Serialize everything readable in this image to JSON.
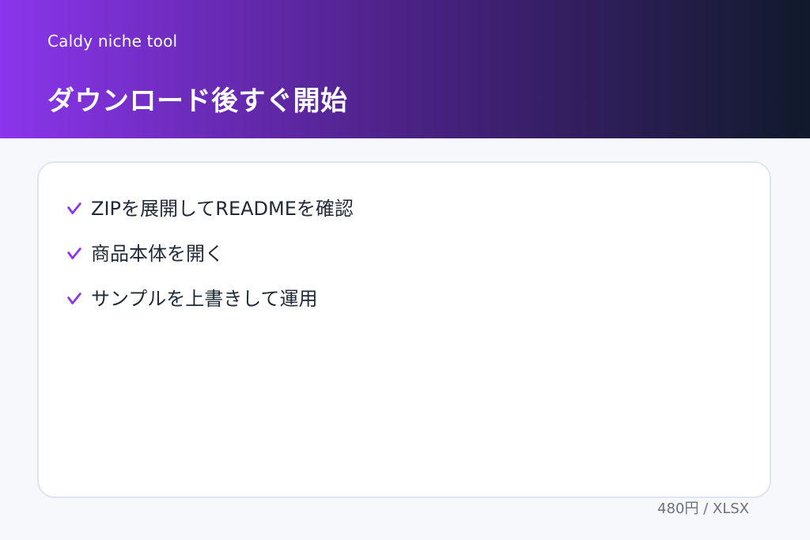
{
  "header": {
    "brand": "Caldy niche tool",
    "title": "ダウンロード後すぐ開始"
  },
  "steps": [
    {
      "label": "ZIPを展開してREADMEを確認",
      "icon": "check-icon"
    },
    {
      "label": "商品本体を開く",
      "icon": "check-icon"
    },
    {
      "label": "サンプルを上書きして運用",
      "icon": "check-icon"
    }
  ],
  "footer": {
    "price_format": "480円 / XLSX"
  },
  "colors": {
    "accent": "#8b35ec",
    "header_dark": "#101a2b",
    "text": "#1f2937",
    "muted": "#6b7280",
    "card_border": "#dfe5ef",
    "background": "#f7f8fb"
  }
}
